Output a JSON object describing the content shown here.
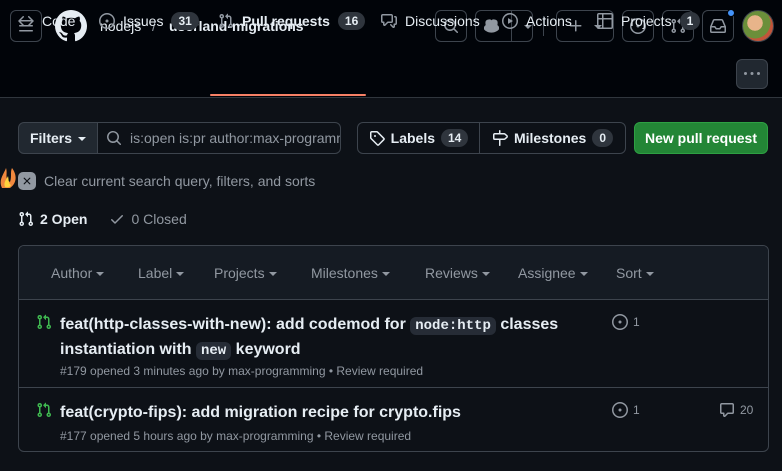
{
  "header": {
    "owner": "nodejs",
    "separator": "/",
    "repo": "userland-migrations"
  },
  "tabs": [
    {
      "label": "Code",
      "icon": "code-icon"
    },
    {
      "label": "Issues",
      "count": "31",
      "icon": "issue-opened-icon"
    },
    {
      "label": "Pull requests",
      "count": "16",
      "icon": "git-pull-request-icon",
      "selected": true
    },
    {
      "label": "Discussions",
      "icon": "comment-discussion-icon"
    },
    {
      "label": "Actions",
      "icon": "play-icon"
    },
    {
      "label": "Projects",
      "count": "1",
      "icon": "table-icon"
    }
  ],
  "filter": {
    "filters_label": "Filters",
    "query": "is:open is:pr author:max-programming",
    "labels_label": "Labels",
    "labels_count": "14",
    "milestones_label": "Milestones",
    "milestones_count": "0",
    "new_pr_label": "New pull request",
    "clear_text": "Clear current search query, filters, and sorts"
  },
  "states": {
    "open": "2 Open",
    "closed": "0 Closed"
  },
  "sort_menu": [
    "Author",
    "Label",
    "Projects",
    "Milestones",
    "Reviews",
    "Assignee",
    "Sort"
  ],
  "pull_requests": [
    {
      "title_parts": [
        "feat(http-classes-with-new): add codemod for ",
        "node:http",
        " classes instantiation with ",
        "new",
        " keyword"
      ],
      "meta": "#179 opened 3 minutes ago by max-programming • Review required",
      "linked_issues": "1",
      "comments": ""
    },
    {
      "title_parts": [
        "feat(crypto-fips): add migration recipe for crypto.fips"
      ],
      "meta": "#177 opened 5 hours ago by max-programming • Review required",
      "linked_issues": "1",
      "comments": "20"
    }
  ],
  "colors": {
    "accent_underline": "#f78166",
    "green_button": "#238636",
    "open_pr_icon": "#3fb950",
    "background": "#0d1117"
  }
}
